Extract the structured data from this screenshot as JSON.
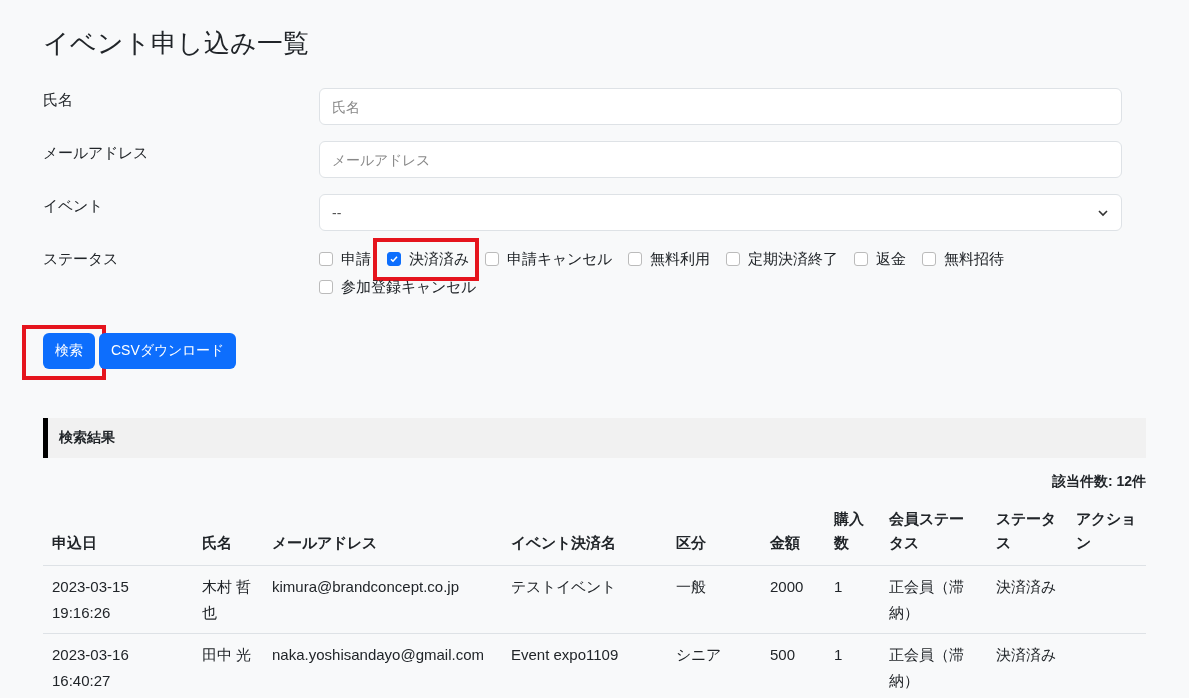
{
  "title": "イベント申し込み一覧",
  "filters": [
    {
      "kind": "text",
      "label": "氏名",
      "placeholder": "氏名"
    },
    {
      "kind": "text",
      "label": "メールアドレス",
      "placeholder": "メールアドレス"
    },
    {
      "kind": "select",
      "label": "イベント",
      "value": "--"
    }
  ],
  "status_filter": {
    "label": "ステータス",
    "options": [
      {
        "label": "申請",
        "checked": false,
        "highlighted": false
      },
      {
        "label": "決済済み",
        "checked": true,
        "highlighted": true
      },
      {
        "label": "申請キャンセル",
        "checked": false,
        "highlighted": false
      },
      {
        "label": "無料利用",
        "checked": false,
        "highlighted": false
      },
      {
        "label": "定期決済終了",
        "checked": false,
        "highlighted": false
      },
      {
        "label": "返金",
        "checked": false,
        "highlighted": false
      },
      {
        "label": "無料招待",
        "checked": false,
        "highlighted": false
      },
      {
        "label": "参加登録キャンセル",
        "checked": false,
        "highlighted": false
      }
    ]
  },
  "buttons": [
    {
      "label": "検索",
      "highlighted": true
    },
    {
      "label": "CSVダウンロード",
      "highlighted": false
    }
  ],
  "results": {
    "heading": "検索結果",
    "count": "該当件数: 12件",
    "columns": [
      "申込日",
      "氏名",
      "メールアドレス",
      "イベント決済名",
      "区分",
      "金額",
      "購入数",
      "会員ステータス",
      "ステータス",
      "アクション"
    ],
    "rows": [
      [
        "2023-03-15 19:16:26",
        "木村 哲也",
        "kimura@brandconcept.co.jp",
        "テストイベント",
        "一般",
        "2000",
        "1",
        "正会員（滞納）",
        "決済済み",
        ""
      ],
      [
        "2023-03-16 16:40:27",
        "田中 光",
        "naka.yoshisandayo@gmail.com",
        "Event expo1109",
        "シニア",
        "500",
        "1",
        "正会員（滞納）",
        "決済済み",
        ""
      ]
    ]
  }
}
